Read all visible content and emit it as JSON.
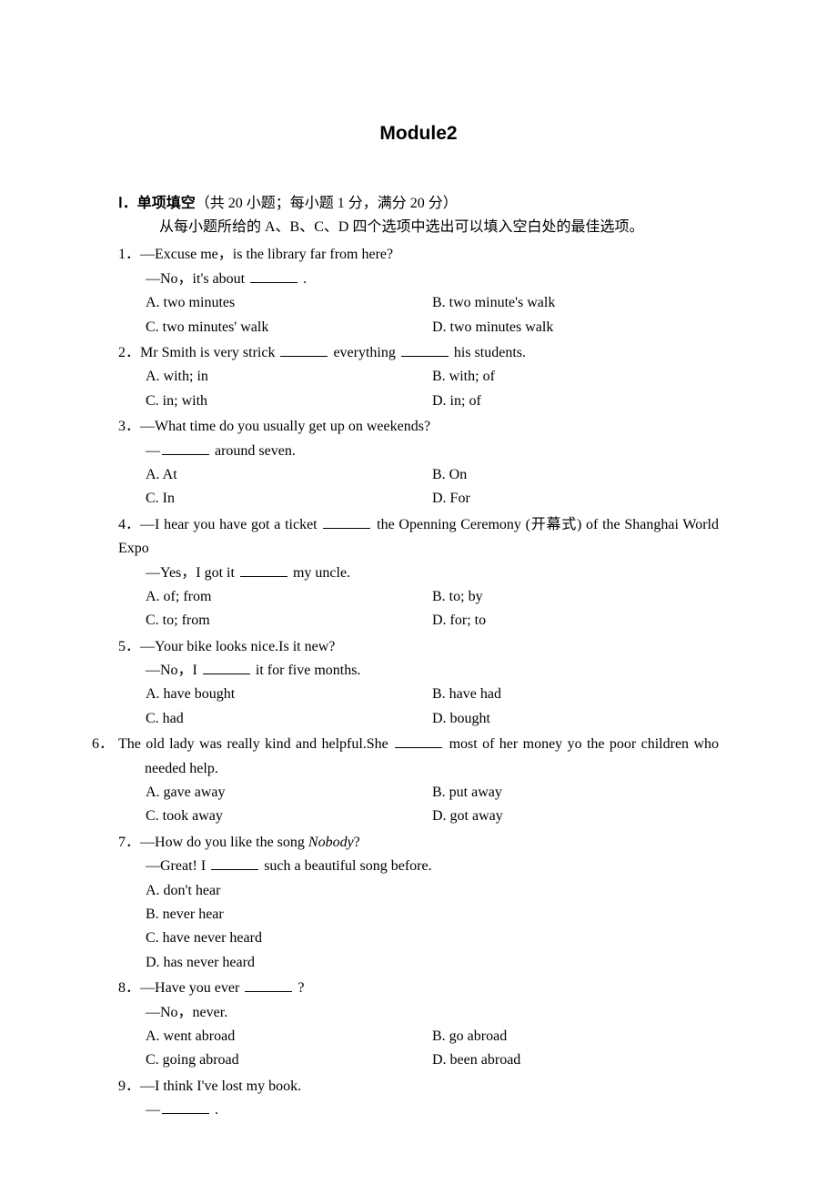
{
  "title": "Module2",
  "section": {
    "roman": "Ⅰ．",
    "head": "单项填空",
    "paren": "（共 20 小题；每小题 1 分，满分 20 分）",
    "sub": "从每小题所给的 A、B、C、D 四个选项中选出可以填入空白处的最佳选项。"
  },
  "q1": {
    "num": "1．",
    "line1a": "—Excuse me，is the library far from here?",
    "line2a": "—No，it's about ",
    "line2b": " .",
    "A": "A. two minutes",
    "B": "B. two minute's walk",
    "C": "C. two minutes' walk",
    "D": "D. two minutes walk"
  },
  "q2": {
    "num": "2．",
    "line1a": "Mr Smith is very strick ",
    "line1b": " everything ",
    "line1c": " his students.",
    "A": "A. with; in",
    "B": "B. with; of",
    "C": "C. in; with",
    "D": "D. in; of"
  },
  "q3": {
    "num": "3．",
    "line1": "—What time do you usually get up on weekends?",
    "line2a": "—",
    "line2b": " around seven.",
    "A": "A. At",
    "B": "B. On",
    "C": "C. In",
    "D": "D. For"
  },
  "q4": {
    "num": "4．",
    "line1a": "—I hear you have got a ticket ",
    "line1b": " the Openning Ceremony (开幕式) of the Shanghai World Expo",
    "line2a": "—Yes，I got it ",
    "line2b": " my uncle.",
    "A": "A. of; from",
    "B": " B. to; by",
    "C": "C. to; from",
    "D": " D. for; to"
  },
  "q5": {
    "num": "5．",
    "line1": "—Your bike looks nice.Is it new?",
    "line2a": "—No，I ",
    "line2b": " it for five months.",
    "A": "A. have bought",
    "B": "B. have had",
    "C": "C. had",
    "D": "D. bought"
  },
  "q6": {
    "num": "6．",
    "line1a": "The old lady was really kind and helpful.She ",
    "line1b": " most of her money yo the poor children who needed help.",
    "A": "A. gave away",
    "B": "B. put away",
    "C": "C. took away",
    "D": "D. got away"
  },
  "q7": {
    "num": "7．",
    "line1a": "—How do you like the song ",
    "italic": "Nobody",
    "line1b": "?",
    "line2a": "—Great! I ",
    "line2b": " such a beautiful song before.",
    "A": "A.  don't hear",
    "B": "B.  never hear",
    "C": "C.  have never heard",
    "D": "D.  has never heard"
  },
  "q8": {
    "num": "8．",
    "line1a": "—Have you ever ",
    "line1b": " ?",
    "line2": "—No，never.",
    "A": "A. went abroad",
    "B": " B. go abroad",
    "C": "C. going abroad",
    "D": " D. been abroad"
  },
  "q9": {
    "num": "9．",
    "line1": "—I think I've lost my book.",
    "line2a": "—",
    "line2b": " ."
  }
}
